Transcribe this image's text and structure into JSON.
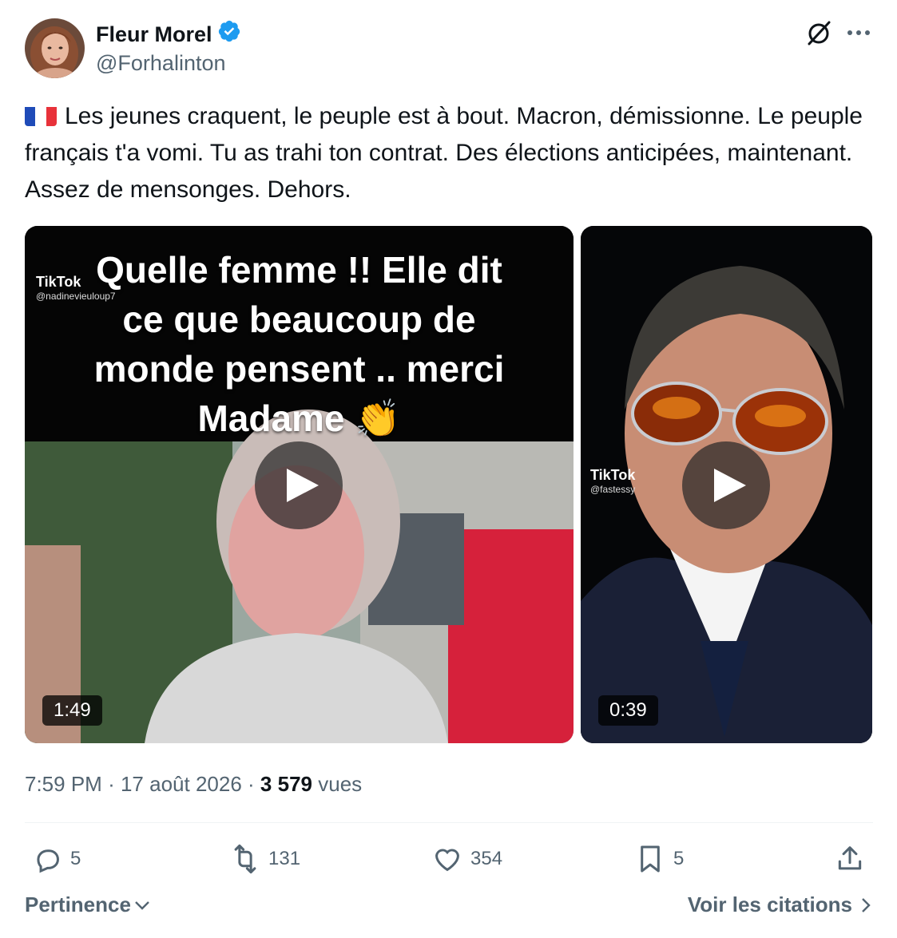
{
  "author": {
    "name": "Fleur Morel",
    "handle": "@Forhalinton",
    "verified_color": "#1d9bf0"
  },
  "tweet": {
    "flag": "FR",
    "text": "Les jeunes craquent, le peuple est à bout. Macron, démissionne. Le peuple français t'a vomi. Tu as trahi ton contrat. Des élections anticipées, maintenant. Assez de mensonges. Dehors."
  },
  "media": [
    {
      "caption_lines": [
        "Quelle femme !! Elle dit",
        "ce que beaucoup de",
        "monde pensent .. merci",
        "Madame 👏"
      ],
      "watermark_brand": "TikTok",
      "watermark_user": "@nadinevieuloup7",
      "duration": "1:49"
    },
    {
      "watermark_brand": "TikTok",
      "watermark_user": "@fastessy",
      "duration": "0:39"
    }
  ],
  "meta": {
    "time": "7:59 PM",
    "separator": "·",
    "date": "17 août 2026",
    "views_count": "3 579",
    "views_label": "vues"
  },
  "actions": {
    "replies": "5",
    "reposts": "131",
    "likes": "354",
    "bookmarks": "5"
  },
  "footer": {
    "sort_label": "Pertinence",
    "quotes_label": "Voir les citations"
  },
  "colors": {
    "text_primary": "#0f1419",
    "text_secondary": "#536471",
    "divider": "#eff3f4"
  }
}
